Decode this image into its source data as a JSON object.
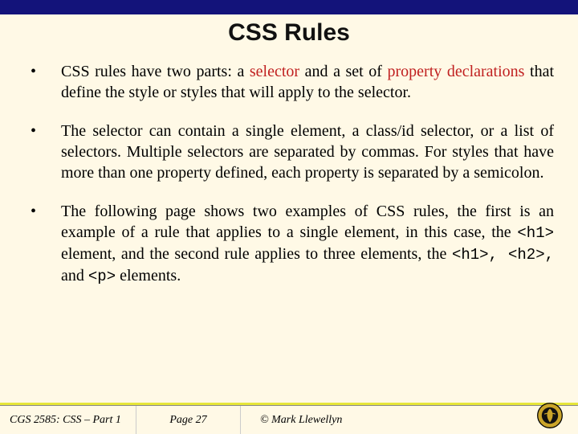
{
  "slide": {
    "title": "CSS Rules",
    "bullets": [
      {
        "pre1": "CSS rules have two parts:  a ",
        "hl1": "selector",
        "mid1": " and a set of ",
        "hl2": "property declarations",
        "post1": " that define the style or styles that will apply to the selector."
      },
      {
        "text": "The selector can contain a single element, a class/id selector, or a list of selectors.  Multiple selectors are separated by commas.  For styles that have more than one property defined, each property is separated by a semicolon."
      },
      {
        "pre": "The following page shows two examples of CSS rules, the first is an example of a rule that applies to a single element, in this case, the ",
        "code1": "<h1>",
        "mid1": " element, and the second rule applies to three elements, the ",
        "code2": "<h1>",
        "sep1": ", ",
        "code3": "<h2>",
        "sep2": ", ",
        "mid2": "and ",
        "code4": "<p>",
        "post": " elements."
      }
    ]
  },
  "footer": {
    "course": "CGS 2585: CSS – Part 1",
    "page": "Page 27",
    "copyright": "© Mark Llewellyn"
  },
  "icons": {
    "logo": "ucf-pegasus-seal"
  }
}
